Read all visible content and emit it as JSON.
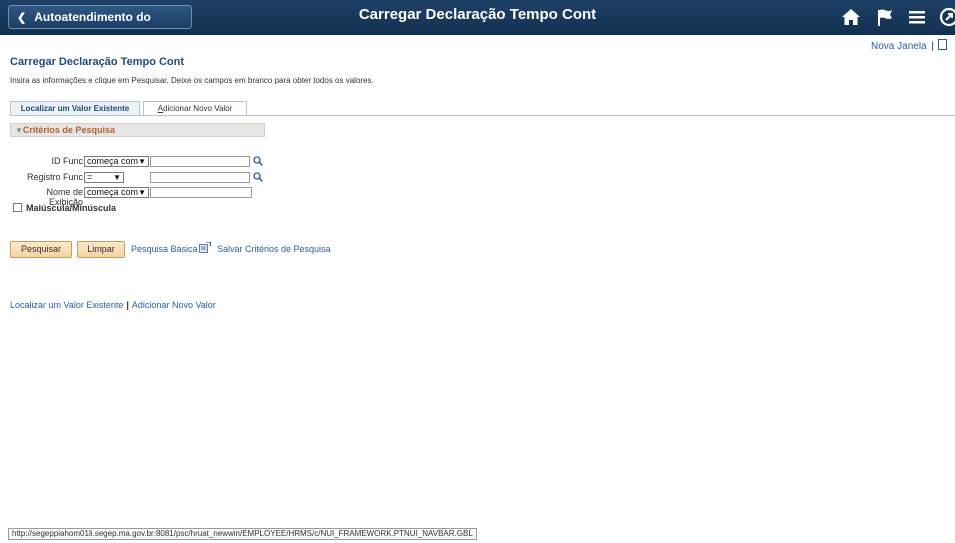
{
  "header": {
    "back_label": "Autoatendimento do Gerente",
    "title": "Carregar Declaração Tempo Cont"
  },
  "utility": {
    "new_window": "Nova Janela",
    "separator": "|"
  },
  "page": {
    "title": "Carregar Declaração Tempo Cont",
    "instructions": "Insira as informações e clique em Pesquisar. Deixe os campos em branco para obter todos os valores."
  },
  "tabs": [
    {
      "label": "Localizar um Valor Existente"
    },
    {
      "access_key": "A",
      "label_rest": "dicionar Novo Valor"
    }
  ],
  "criteria": {
    "header": "Critérios de Pesquisa"
  },
  "fields": [
    {
      "label": "ID Func",
      "operator": "começa com",
      "value": ""
    },
    {
      "label": "Registro Func",
      "operator": "=",
      "value": ""
    },
    {
      "label": "Nome de Exibição",
      "operator": "começa com",
      "value": ""
    }
  ],
  "case_checkbox": {
    "label": "Maiúscula/Minúscula",
    "checked": false
  },
  "actions": {
    "search": "Pesquisar",
    "clear": "Limpar",
    "basic_search": "Pesquisa Básica",
    "save_criteria": "Salvar Critérios de Pesquisa"
  },
  "bottom_links": {
    "find_existing": "Localizar um Valor Existente",
    "separator": "|",
    "add_new": "Adicionar Novo Valor"
  },
  "status_url": "http://segeppiahom01li.segep.ma.gov.br:8081/psc/hruat_newwin/EMPLOYEE/HRMS/c/NUI_FRAMEWORK.PTNUI_NAVBAR.GBL",
  "colors": {
    "header_bg": "#1a3a5e",
    "link": "#2e5ba7",
    "title": "#1e4c7d",
    "criteria_text": "#b45f2b",
    "button_bg": "#f7dbb0"
  },
  "icons": [
    "chevron-left-icon",
    "home-icon",
    "flag-icon",
    "menu-icon",
    "navbar-icon",
    "lookup-icon",
    "save-criteria-icon"
  ]
}
